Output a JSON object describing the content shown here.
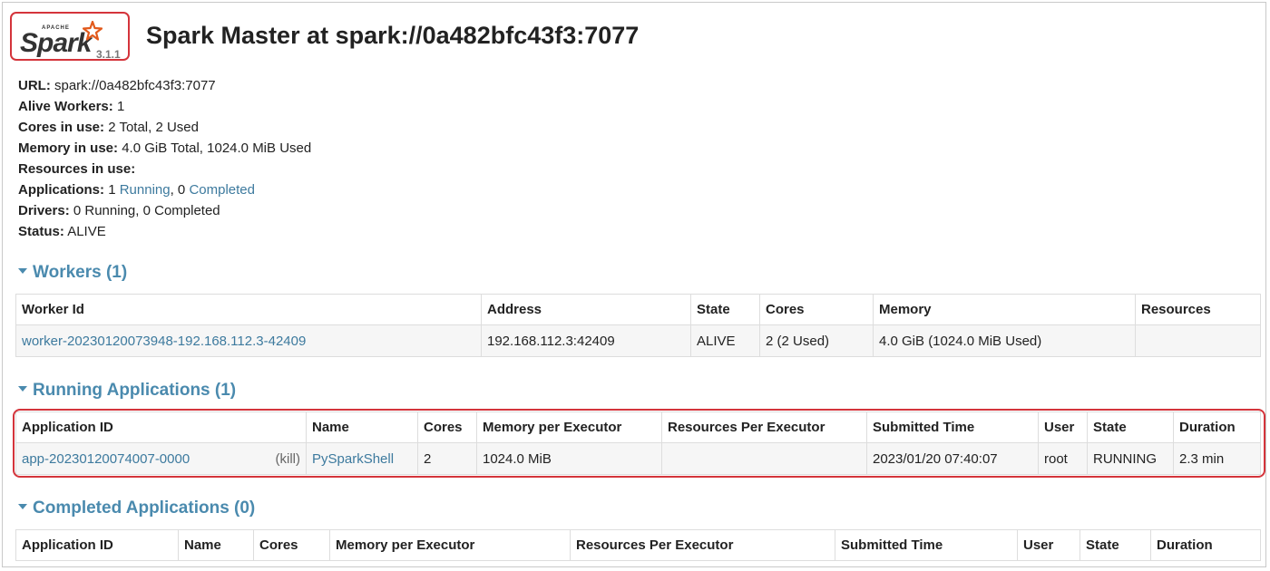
{
  "header": {
    "logo_apache": "APACHE",
    "logo_spark": "Spark",
    "version": "3.1.1",
    "title": "Spark Master at spark://0a482bfc43f3:7077"
  },
  "summary": {
    "url_label": "URL:",
    "url_value": "spark://0a482bfc43f3:7077",
    "alive_workers_label": "Alive Workers:",
    "alive_workers_value": "1",
    "cores_label": "Cores in use:",
    "cores_value": "2 Total, 2 Used",
    "memory_label": "Memory in use:",
    "memory_value": "4.0 GiB Total, 1024.0 MiB Used",
    "resources_label": "Resources in use:",
    "applications_label": "Applications:",
    "applications_running_count": "1",
    "applications_running_link": "Running",
    "applications_completed_count": ", 0",
    "applications_completed_link": "Completed",
    "drivers_label": "Drivers:",
    "drivers_value": "0 Running, 0 Completed",
    "status_label": "Status:",
    "status_value": "ALIVE"
  },
  "workers": {
    "heading": "Workers (1)",
    "columns": [
      "Worker Id",
      "Address",
      "State",
      "Cores",
      "Memory",
      "Resources"
    ],
    "rows": [
      {
        "worker_id": "worker-20230120073948-192.168.112.3-42409",
        "address": "192.168.112.3:42409",
        "state": "ALIVE",
        "cores": "2 (2 Used)",
        "memory": "4.0 GiB (1024.0 MiB Used)",
        "resources": ""
      }
    ]
  },
  "running_apps": {
    "heading": "Running Applications (1)",
    "columns": [
      "Application ID",
      "Name",
      "Cores",
      "Memory per Executor",
      "Resources Per Executor",
      "Submitted Time",
      "User",
      "State",
      "Duration"
    ],
    "rows": [
      {
        "app_id": "app-20230120074007-0000",
        "kill": "(kill)",
        "name": "PySparkShell",
        "cores": "2",
        "memory": "1024.0 MiB",
        "resources": "",
        "submitted": "2023/01/20 07:40:07",
        "user": "root",
        "state": "RUNNING",
        "duration": "2.3 min"
      }
    ]
  },
  "completed_apps": {
    "heading": "Completed Applications (0)",
    "columns": [
      "Application ID",
      "Name",
      "Cores",
      "Memory per Executor",
      "Resources Per Executor",
      "Submitted Time",
      "User",
      "State",
      "Duration"
    ]
  },
  "colors": {
    "link": "#3d7a9e",
    "section_header": "#4a8aae",
    "highlight_border": "#d4343b",
    "row_background": "#f6f6f6"
  }
}
